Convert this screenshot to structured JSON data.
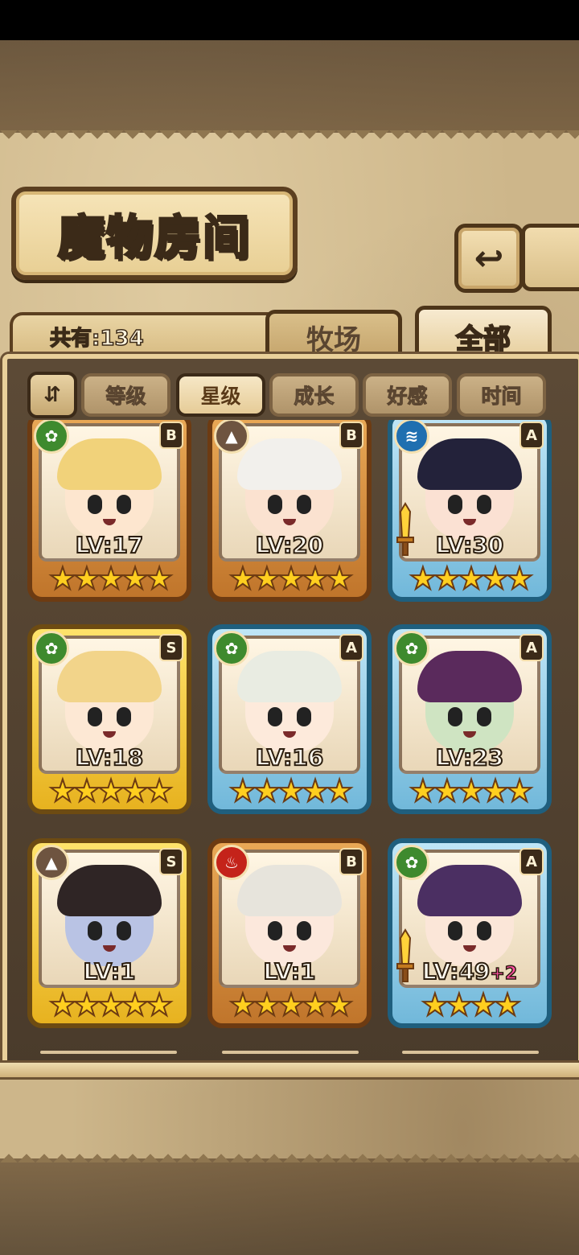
{
  "header": {
    "title": "魔物房间",
    "back_icon": "↩",
    "count_text": "共有:134"
  },
  "tabs": [
    {
      "label": "牧场",
      "active": false
    },
    {
      "label": "全部",
      "active": true
    }
  ],
  "sort": {
    "toggle_icon": "⇵",
    "buttons": [
      {
        "label": "等级",
        "active": false
      },
      {
        "label": "星级",
        "active": true
      },
      {
        "label": "成长",
        "active": false
      },
      {
        "label": "好感",
        "active": false
      },
      {
        "label": "时间",
        "active": false
      }
    ]
  },
  "cards": [
    {
      "level": "LV:17",
      "plus": "",
      "rank": "B",
      "element": "leaf",
      "elem_icon": "✿",
      "stars": "★★★★★",
      "frame": "bronze",
      "hair": "#f1d27a",
      "skin": "#fde6cf",
      "weapon": false
    },
    {
      "level": "LV:20",
      "plus": "",
      "rank": "B",
      "element": "earth",
      "elem_icon": "▲",
      "stars": "★★★★★",
      "frame": "bronze",
      "hair": "#f2f0ec",
      "skin": "#fbe2d0",
      "weapon": false
    },
    {
      "level": "LV:30",
      "plus": "",
      "rank": "A",
      "element": "water",
      "elem_icon": "≋",
      "stars": "★★★★★",
      "frame": "ice",
      "hair": "#23223a",
      "skin": "#fbe1d3",
      "weapon": true
    },
    {
      "level": "LV:18",
      "plus": "",
      "rank": "S",
      "element": "leaf",
      "elem_icon": "✿",
      "stars": "★★★★★",
      "frame": "gold",
      "hair": "#f2d48a",
      "skin": "#fde8d4",
      "weapon": false
    },
    {
      "level": "LV:16",
      "plus": "",
      "rank": "A",
      "element": "leaf",
      "elem_icon": "✿",
      "stars": "★★★★★",
      "frame": "ice",
      "hair": "#e9ece2",
      "skin": "#fdeadb",
      "weapon": false
    },
    {
      "level": "LV:23",
      "plus": "",
      "rank": "A",
      "element": "leaf",
      "elem_icon": "✿",
      "stars": "★★★★★",
      "frame": "ice",
      "hair": "#5a2a5c",
      "skin": "#cfe4c2",
      "weapon": false
    },
    {
      "level": "LV:1",
      "plus": "",
      "rank": "S",
      "element": "earth",
      "elem_icon": "▲",
      "stars": "★★★★★",
      "frame": "gold",
      "hair": "#2f2525",
      "skin": "#b9c3e4",
      "weapon": false
    },
    {
      "level": "LV:1",
      "plus": "",
      "rank": "B",
      "element": "fire",
      "elem_icon": "♨",
      "stars": "★★★★★",
      "frame": "bronze",
      "hair": "#e7e4dc",
      "skin": "#fce8dc",
      "weapon": false
    },
    {
      "level": "LV:49",
      "plus": "+2",
      "rank": "A",
      "element": "leaf",
      "elem_icon": "✿",
      "stars": "★★★★",
      "frame": "ice",
      "hair": "#4b2f62",
      "skin": "#fbe6d8",
      "weapon": true
    }
  ]
}
